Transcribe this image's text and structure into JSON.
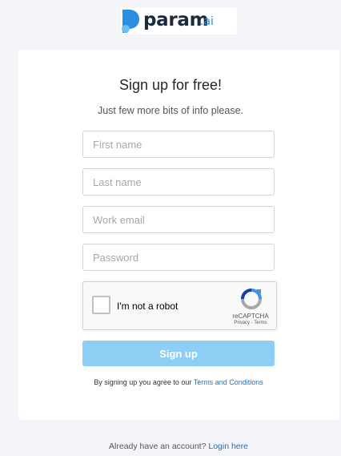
{
  "brand": {
    "name": "param",
    "suffix": ".ai",
    "colors": {
      "mark": "#2a8fe0",
      "text": "#1a2b3d"
    }
  },
  "form": {
    "title": "Sign up for free!",
    "subtitle": "Just few more bits of info please.",
    "fields": [
      {
        "placeholder": "First name",
        "value": ""
      },
      {
        "placeholder": "Last name",
        "value": ""
      },
      {
        "placeholder": "Work email",
        "value": ""
      },
      {
        "placeholder": "Password",
        "value": ""
      }
    ],
    "captcha": {
      "label": "I'm not a robot",
      "brand": "reCAPTCHA",
      "privacy": "Privacy",
      "terms": "Terms",
      "checked": false
    },
    "submit_label": "Sign up",
    "terms_text": "By signing up you agree to our",
    "terms_link": "Terms and Conditions"
  },
  "footer": {
    "text": "Already have an account?",
    "link": "Login here"
  },
  "colors": {
    "background": "#f3f5f8",
    "button": "#8ecdf4",
    "link": "#1f6fb5"
  }
}
